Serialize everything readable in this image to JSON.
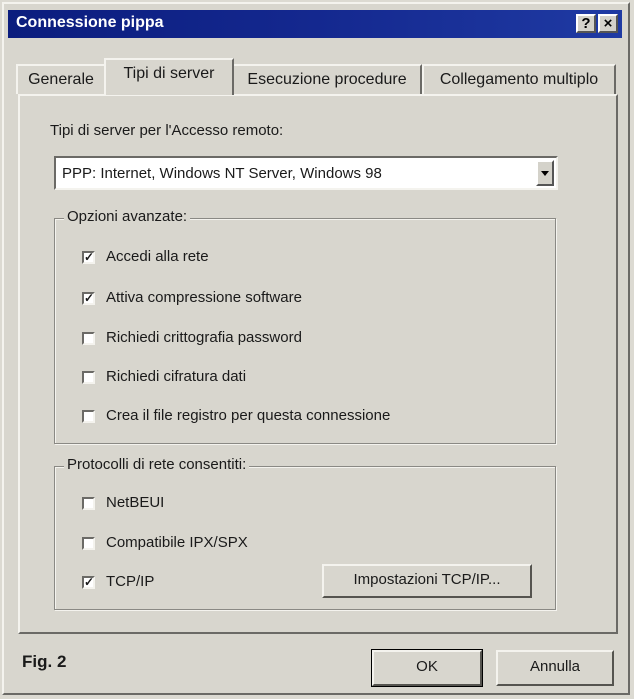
{
  "window": {
    "title": "Connessione pippa",
    "help_label": "?",
    "close_label": "×"
  },
  "tabs": [
    {
      "label": "Generale",
      "active": false
    },
    {
      "label": "Tipi di server",
      "active": true
    },
    {
      "label": "Esecuzione procedure",
      "active": false
    },
    {
      "label": "Collegamento multiplo",
      "active": false
    }
  ],
  "server_types": {
    "label": "Tipi di server per l'Accesso remoto:",
    "selected": "PPP: Internet, Windows NT Server, Windows 98"
  },
  "advanced": {
    "legend": "Opzioni avanzate:",
    "options": [
      {
        "label": "Accedi alla rete",
        "checked": true
      },
      {
        "label": "Attiva compressione software",
        "checked": true
      },
      {
        "label": "Richiedi crittografia password",
        "checked": false
      },
      {
        "label": "Richiedi cifratura dati",
        "checked": false
      },
      {
        "label": "Crea il file registro per questa connessione",
        "checked": false
      }
    ]
  },
  "protocols": {
    "legend": "Protocolli di rete consentiti:",
    "options": [
      {
        "label": "NetBEUI",
        "checked": false
      },
      {
        "label": "Compatibile IPX/SPX",
        "checked": false
      },
      {
        "label": "TCP/IP",
        "checked": true
      }
    ],
    "tcpip_settings_label": "Impostazioni TCP/IP..."
  },
  "footer": {
    "caption": "Fig. 2",
    "ok_label": "OK",
    "cancel_label": "Annulla"
  },
  "check_mark": "✓"
}
